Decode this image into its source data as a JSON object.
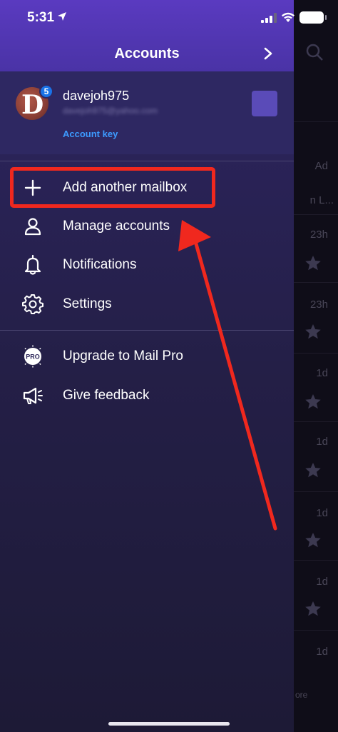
{
  "status_bar": {
    "time": "5:31"
  },
  "drawer": {
    "title": "Accounts",
    "account": {
      "initial": "D",
      "badge_count": "5",
      "username": "davejoh975",
      "email": "davejoh975@yahoo.com",
      "account_key_label": "Account key"
    },
    "menu": [
      {
        "label": "Add another mailbox",
        "icon": "plus-icon"
      },
      {
        "label": "Manage accounts",
        "icon": "person-icon"
      },
      {
        "label": "Notifications",
        "icon": "bell-icon"
      },
      {
        "label": "Settings",
        "icon": "gear-icon"
      }
    ],
    "menu2": [
      {
        "label": "Upgrade to Mail Pro",
        "icon": "pro-badge-icon"
      },
      {
        "label": "Give feedback",
        "icon": "megaphone-icon"
      }
    ]
  },
  "background_list": {
    "items": [
      {
        "time": "Ad"
      },
      {
        "time": "n L..."
      },
      {
        "time": "23h"
      },
      {
        "time": "23h"
      },
      {
        "time": "1d"
      },
      {
        "time": "1d"
      },
      {
        "time": "1d"
      },
      {
        "time": "1d"
      },
      {
        "time": "1d"
      }
    ],
    "more_label": "ore"
  },
  "colors": {
    "highlight": "#f0281e",
    "accent_link": "#3d9bff",
    "header": "#5036b0"
  }
}
